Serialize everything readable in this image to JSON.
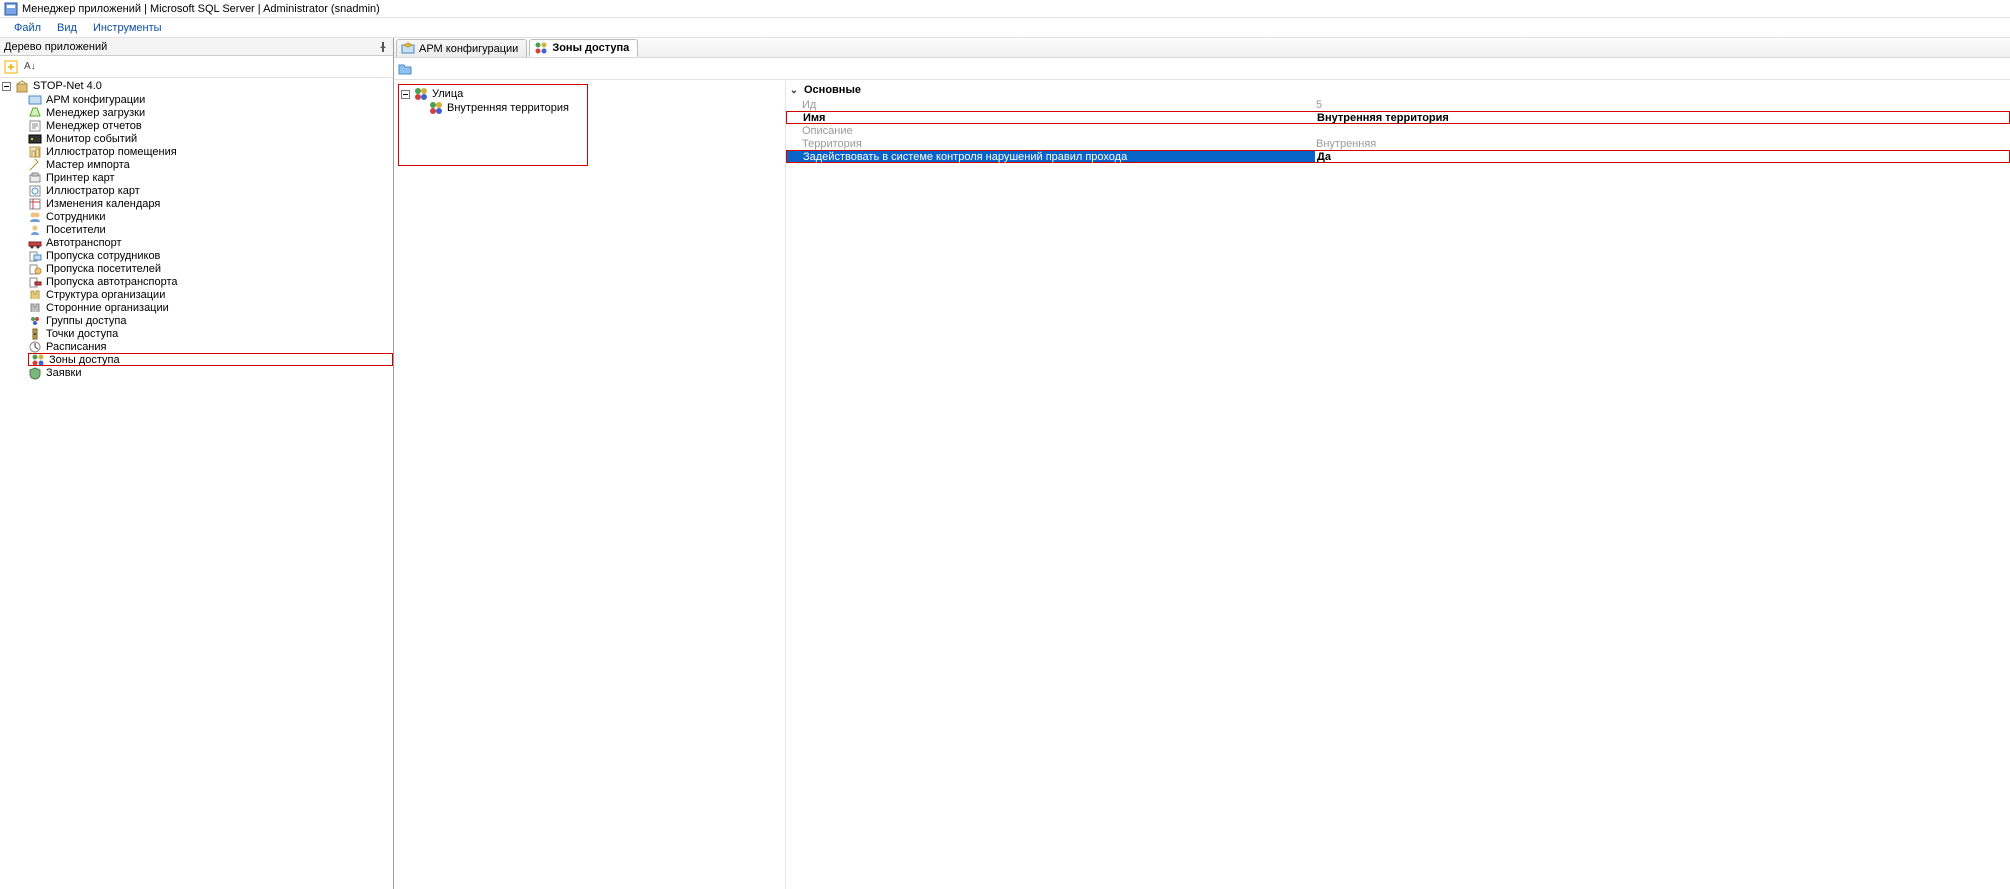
{
  "title": "Менеджер приложений | Microsoft SQL Server | Administrator (snadmin)",
  "menu": {
    "file": "Файл",
    "view": "Вид",
    "tools": "Инструменты"
  },
  "left_panel": {
    "title": "Дерево приложений",
    "sort_label": "А↓",
    "root": "STOP-Net 4.0",
    "items": [
      "АРМ конфигурации",
      "Менеджер загрузки",
      "Менеджер отчетов",
      "Монитор событий",
      "Иллюстратор помещения",
      "Мастер импорта",
      "Принтер карт",
      "Иллюстратор карт",
      "Изменения календаря",
      "Сотрудники",
      "Посетители",
      "Автотранспорт",
      "Пропуска сотрудников",
      "Пропуска посетителей",
      "Пропуска автотранспорта",
      "Структура организации",
      "Сторонние организации",
      "Группы доступа",
      "Точки доступа",
      "Расписания",
      "Зоны доступа",
      "Заявки"
    ],
    "highlighted_index": 20
  },
  "tabs": [
    {
      "label": "АРМ конфигурации",
      "active": false
    },
    {
      "label": "Зоны доступа",
      "active": true
    }
  ],
  "zone_tree": {
    "root": "Улица",
    "child": "Внутренняя территория"
  },
  "properties": {
    "group_label": "Основные",
    "rows": [
      {
        "label": "Ид",
        "value": "5",
        "style": "disabled"
      },
      {
        "label": "Имя",
        "value": "Внутренняя территория",
        "style": "boxed"
      },
      {
        "label": "Описание",
        "value": "",
        "style": "disabled"
      },
      {
        "label": "Территория",
        "value": "Внутренняя",
        "style": "disabled"
      },
      {
        "label": "Задействовать в системе контроля нарушений правил прохода",
        "value": "Да",
        "style": "selected"
      }
    ]
  }
}
